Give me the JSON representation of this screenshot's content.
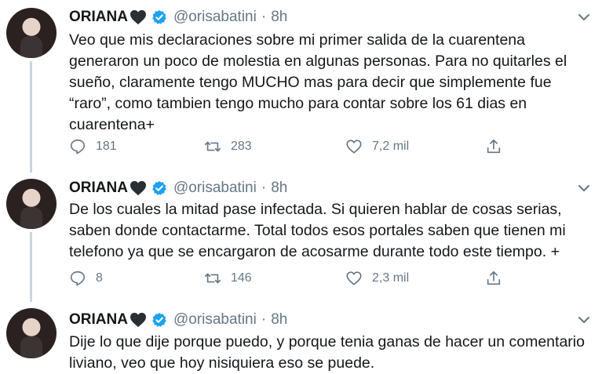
{
  "tweets": [
    {
      "name": "ORIANA",
      "handle": "@orisabatini",
      "separator": "·",
      "time": "8h",
      "lines": [
        "Veo que mis declaraciones sobre mi primer salida de la cuarentena",
        "generaron un poco de molestia en algunas personas. Para no quitarles el",
        "sueño, claramente tengo MUCHO mas para decir que simplemente fue",
        "“raro”, como tambien tengo mucho para contar sobre los 61 dias en",
        "cuarentena+"
      ],
      "replies": "181",
      "retweets": "283",
      "likes": "7,2 mil"
    },
    {
      "name": "ORIANA",
      "handle": "@orisabatini",
      "separator": "·",
      "time": "8h",
      "lines": [
        "De los cuales la mitad pase infectada. Si quieren hablar de cosas serias,",
        "saben donde contactarme. Total todos esos portales saben que tienen mi",
        "telefono ya que se encargaron de acosarme durante todo este tiempo. +"
      ],
      "replies": "8",
      "retweets": "146",
      "likes": "2,3 mil"
    },
    {
      "name": "ORIANA",
      "handle": "@orisabatini",
      "separator": "·",
      "time": "8h",
      "lines": [
        "Dije lo que dije porque puedo, y porque tenia ganas de hacer un comentario",
        "liviano, veo que hoy nisiquiera eso se puede."
      ]
    }
  ],
  "icons": {
    "heart": "black-heart-icon",
    "verified": "verified-badge-icon",
    "more": "chevron-down-icon",
    "reply": "reply-icon",
    "retweet": "retweet-icon",
    "like": "like-icon",
    "share": "share-icon"
  },
  "colors": {
    "text": "#14171a",
    "secondary": "#657786",
    "verified": "#1da1f2",
    "thread_line": "#ccd6dd"
  }
}
